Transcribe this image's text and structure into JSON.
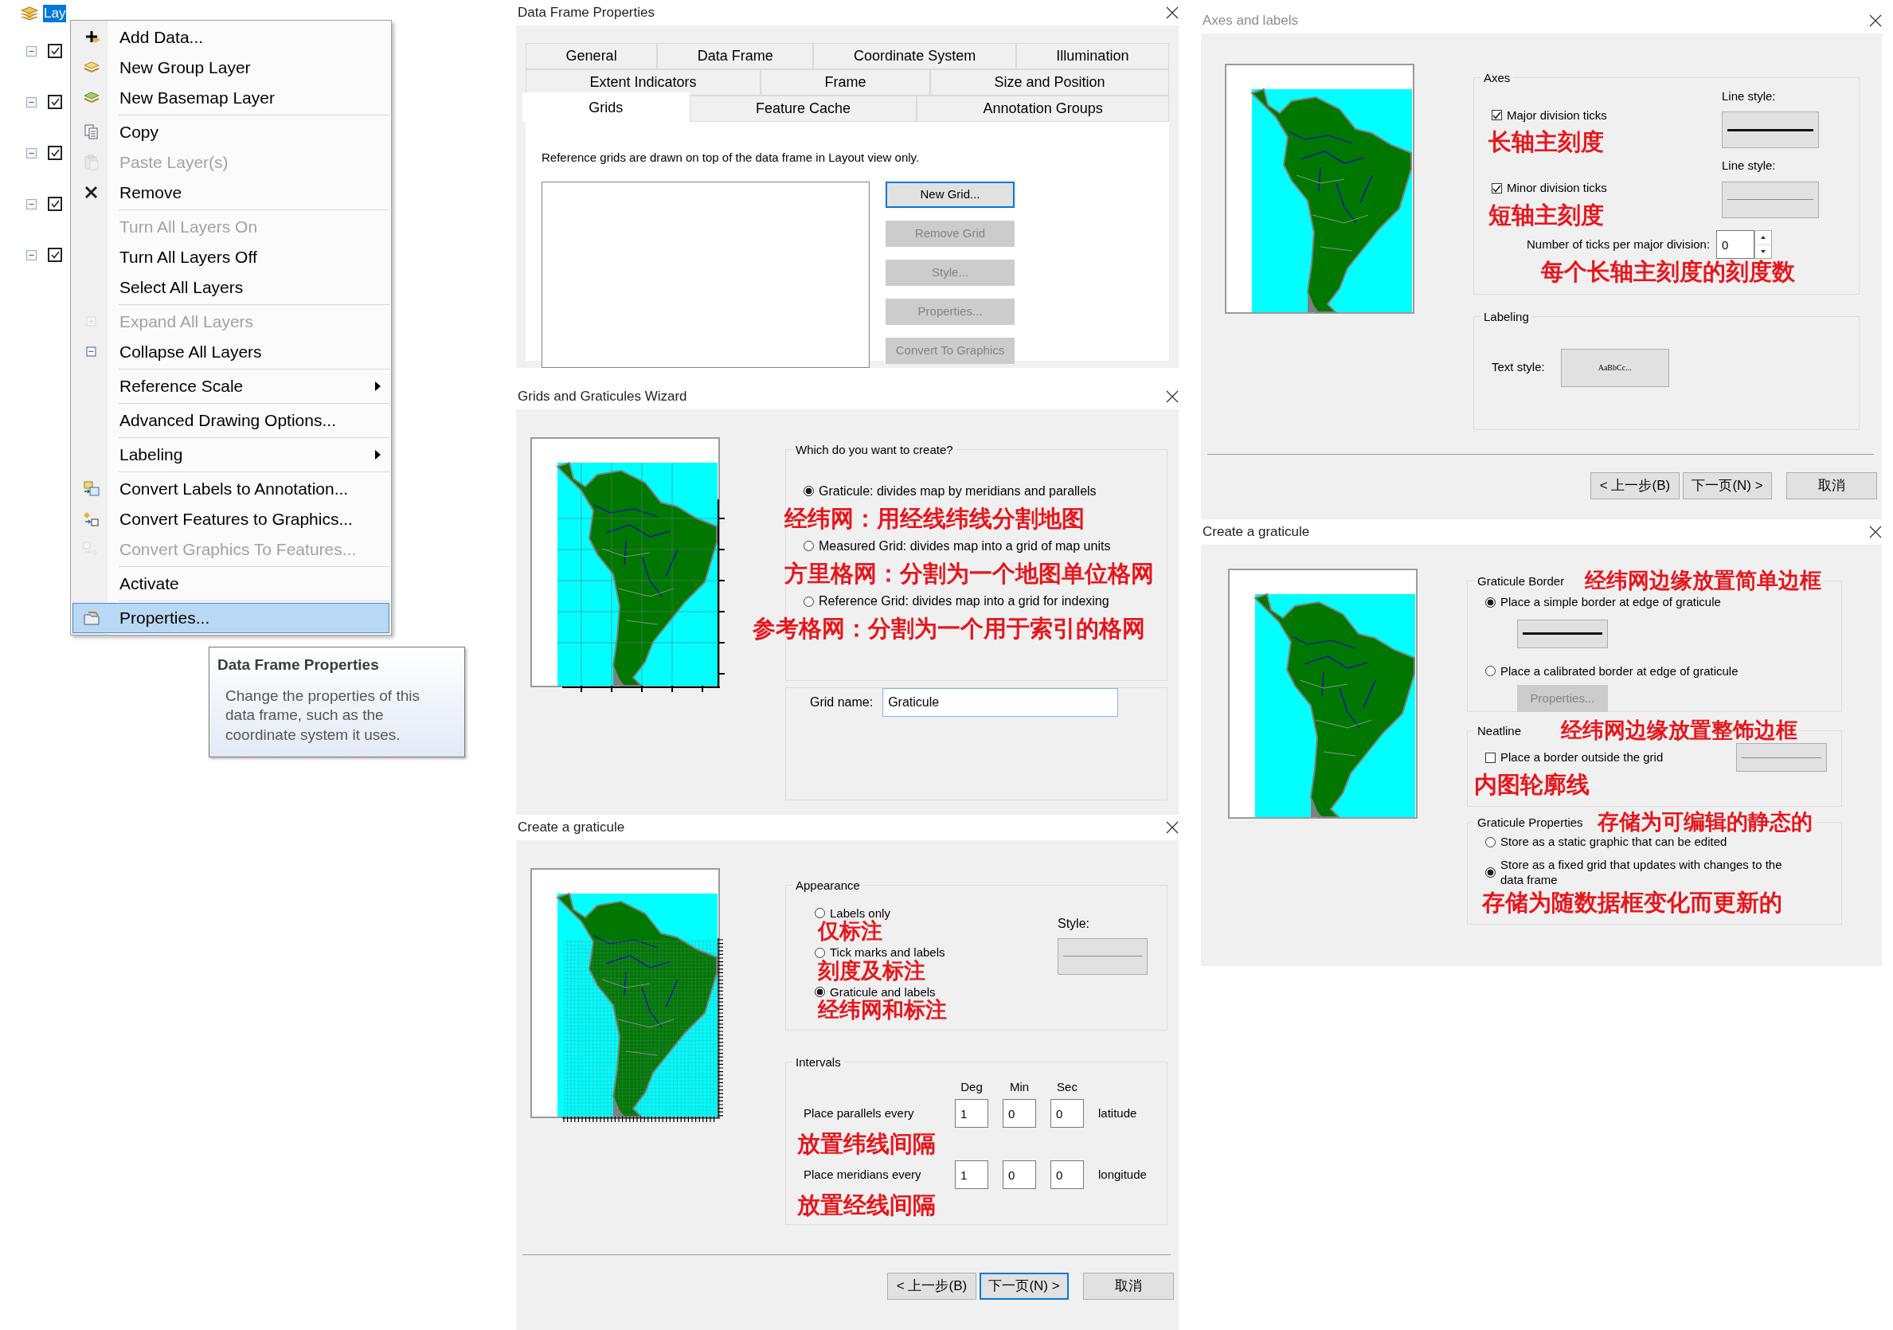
{
  "layers_panel": {
    "root": {
      "label": "Lay",
      "selected": true
    },
    "layers": [
      {
        "expanded": true,
        "checked": true
      },
      {
        "expanded": true,
        "checked": true
      },
      {
        "expanded": true,
        "checked": true
      },
      {
        "expanded": true,
        "checked": true
      },
      {
        "expanded": true,
        "checked": true
      }
    ]
  },
  "context_menu": {
    "groups": [
      [
        {
          "label": "Add Data...",
          "kind": "action",
          "disabled": false,
          "selected": false
        },
        {
          "label": "New Group Layer",
          "kind": "action",
          "disabled": false,
          "selected": false
        },
        {
          "label": "New Basemap Layer",
          "kind": "action",
          "disabled": false,
          "selected": false
        }
      ],
      [
        {
          "label": "Copy",
          "kind": "action",
          "disabled": false,
          "selected": false
        },
        {
          "label": "Paste Layer(s)",
          "kind": "action",
          "disabled": true,
          "selected": false
        },
        {
          "label": "Remove",
          "kind": "action",
          "disabled": false,
          "selected": false
        }
      ],
      [
        {
          "label": "Turn All Layers On",
          "kind": "action",
          "disabled": true,
          "selected": false
        },
        {
          "label": "Turn All Layers Off",
          "kind": "action",
          "disabled": false,
          "selected": false
        },
        {
          "label": "Select All Layers",
          "kind": "action",
          "disabled": false,
          "selected": false
        }
      ],
      [
        {
          "label": "Expand All Layers",
          "kind": "action",
          "disabled": true,
          "selected": false
        },
        {
          "label": "Collapse All Layers",
          "kind": "action",
          "disabled": false,
          "selected": false
        }
      ],
      [
        {
          "label": "Reference Scale",
          "kind": "submenu",
          "disabled": false,
          "selected": false
        }
      ],
      [
        {
          "label": "Advanced Drawing Options...",
          "kind": "action",
          "disabled": false,
          "selected": false
        }
      ],
      [
        {
          "label": "Labeling",
          "kind": "submenu",
          "disabled": false,
          "selected": false
        }
      ],
      [
        {
          "label": "Convert Labels to Annotation...",
          "kind": "action",
          "disabled": false,
          "selected": false
        },
        {
          "label": "Convert Features to Graphics...",
          "kind": "action",
          "disabled": false,
          "selected": false
        },
        {
          "label": "Convert Graphics To Features...",
          "kind": "action",
          "disabled": true,
          "selected": false
        }
      ],
      [
        {
          "label": "Activate",
          "kind": "action",
          "disabled": false,
          "selected": false
        }
      ],
      [
        {
          "label": "Properties...",
          "kind": "action",
          "disabled": false,
          "selected": true
        }
      ]
    ]
  },
  "tooltip": {
    "title": "Data Frame Properties",
    "text": "Change the properties of this data frame, such as the coordinate system it uses."
  },
  "data_frame_properties": {
    "title": "Data Frame Properties",
    "active": true,
    "tab_rows": [
      [
        {
          "label": "General",
          "selected": false
        },
        {
          "label": "Data Frame",
          "selected": false
        },
        {
          "label": "Coordinate System",
          "selected": false
        },
        {
          "label": "Illumination",
          "selected": false
        }
      ],
      [
        {
          "label": "Extent Indicators",
          "selected": false
        },
        {
          "label": "Frame",
          "selected": false
        },
        {
          "label": "Size and Position",
          "selected": false
        }
      ],
      [
        {
          "label": "Grids",
          "selected": true
        },
        {
          "label": "Feature Cache",
          "selected": false
        },
        {
          "label": "Annotation Groups",
          "selected": false
        }
      ]
    ],
    "note": "Reference grids are drawn on top of the data frame in Layout view only.",
    "buttons": [
      {
        "label": "New Grid...",
        "disabled": false,
        "default": true
      },
      {
        "label": "Remove Grid",
        "disabled": true,
        "default": false
      },
      {
        "label": "Style...",
        "disabled": true,
        "default": false
      },
      {
        "label": "Properties...",
        "disabled": true,
        "default": false
      },
      {
        "label": "Convert To Graphics",
        "disabled": true,
        "default": false
      }
    ]
  },
  "grids_wizard": {
    "title": "Grids and Graticules Wizard",
    "active": true,
    "question": "Which do you want to create?",
    "options": [
      {
        "label": "Graticule: divides map by meridians and parallels",
        "selected": true,
        "annotation": "经纬网：用经线纬线分割地图"
      },
      {
        "label": "Measured Grid: divides map into a grid of map units",
        "selected": false,
        "annotation": "方里格网：分割为一个地图单位格网"
      },
      {
        "label": "Reference Grid: divides map into a grid for indexing",
        "selected": false,
        "annotation": "参考格网：分割为一个用于索引的格网"
      }
    ],
    "grid_name": {
      "label": "Grid name:",
      "value": "Graticule"
    }
  },
  "graticule_appearance": {
    "title": "Create a graticule",
    "active": true,
    "appearance": {
      "label": "Appearance",
      "style_label": "Style:",
      "options": [
        {
          "label": "Labels only",
          "selected": false,
          "annotation": "仅标注"
        },
        {
          "label": "Tick marks and labels",
          "selected": false,
          "annotation": "刻度及标注"
        },
        {
          "label": "Graticule and labels",
          "selected": true,
          "annotation": "经纬网和标注"
        }
      ]
    },
    "intervals": {
      "label": "Intervals",
      "columns": [
        "Deg",
        "Min",
        "Sec"
      ],
      "rows": [
        {
          "label": "Place parallels every",
          "values": [
            "1",
            "0",
            "0"
          ],
          "unit": "latitude",
          "annotation": "放置纬线间隔"
        },
        {
          "label": "Place meridians every",
          "values": [
            "1",
            "0",
            "0"
          ],
          "unit": "longitude",
          "annotation": "放置经线间隔"
        }
      ]
    },
    "buttons": [
      {
        "label": "< 上一步(B)",
        "default": false
      },
      {
        "label": "下一页(N) >",
        "default": true
      },
      {
        "label": "取消",
        "default": false
      }
    ]
  },
  "axes_labels": {
    "title": "Axes and labels",
    "active": false,
    "axes": {
      "label": "Axes",
      "ticks": [
        {
          "label": "Major division ticks",
          "checked": true,
          "annotation": "长轴主刻度",
          "line_style_label": "Line style:",
          "kind": "major"
        },
        {
          "label": "Minor division ticks",
          "checked": true,
          "annotation": "短轴主刻度",
          "line_style_label": "Line style:",
          "kind": "minor"
        }
      ],
      "count": {
        "label": "Number of ticks per major division:",
        "value": "0",
        "annotation": "每个长轴主刻度的刻度数"
      }
    },
    "labeling": {
      "label": "Labeling",
      "text_style_label": "Text style:",
      "sample": "AaBbCc..."
    },
    "buttons": [
      {
        "label": "< 上一步(B)",
        "default": false
      },
      {
        "label": "下一页(N) >",
        "default": false
      },
      {
        "label": "取消",
        "default": false
      }
    ]
  },
  "graticule_border": {
    "title": "Create a graticule",
    "active": true,
    "border": {
      "label": "Graticule Border",
      "annotation": "经纬网边缘放置简单边框",
      "options": [
        {
          "label": "Place a simple border at edge of graticule",
          "selected": true,
          "kind": "line"
        },
        {
          "label": "Place a calibrated border at edge of graticule",
          "selected": false,
          "kind": "button",
          "button": {
            "label": "Properties...",
            "disabled": true
          }
        }
      ]
    },
    "neatline": {
      "label": "Neatline",
      "annotation": "经纬网边缘放置整饰边框",
      "checkbox": {
        "label": "Place a border outside the grid",
        "checked": false,
        "annotation": "内图轮廓线"
      }
    },
    "properties": {
      "label": "Graticule Properties",
      "annotation": "存储为可编辑的静态的",
      "options": [
        {
          "label": "Store as a static graphic that can be edited",
          "selected": false
        },
        {
          "label": "Store as a fixed grid that updates with changes to the data frame",
          "selected": true,
          "annotation": "存储为随数据框变化而更新的"
        }
      ]
    }
  }
}
